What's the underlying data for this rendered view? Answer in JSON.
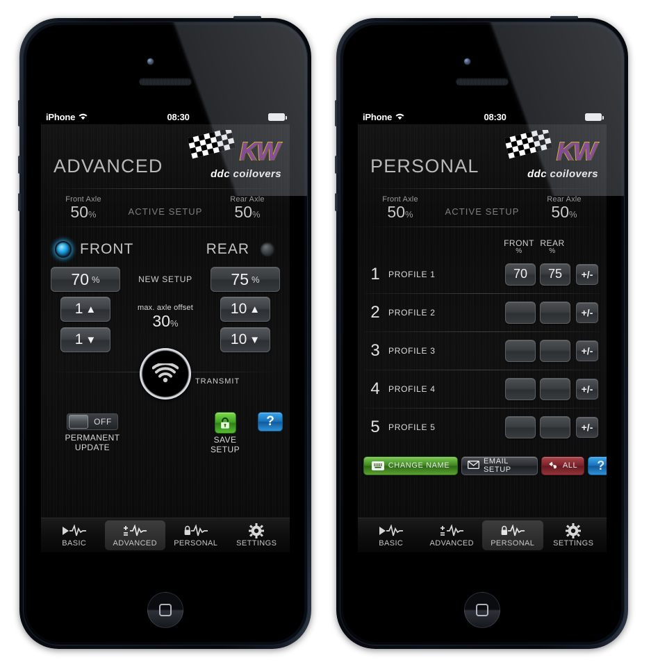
{
  "statusbar": {
    "carrier": "iPhone",
    "time": "08:30",
    "wifi_icon": "wifi-icon",
    "battery_icon": "battery-full-icon"
  },
  "brand": {
    "letters": "KW",
    "tagline": "ddc coilovers",
    "purple": "#7b2a8f",
    "gold": "#e0b400"
  },
  "advanced": {
    "title": "ADVANCED",
    "active_setup": {
      "label": "ACTIVE SETUP",
      "front_caption": "Front Axle",
      "front_value": "50",
      "rear_caption": "Rear Axle",
      "rear_value": "50",
      "unit": "%"
    },
    "axle_select": {
      "front_label": "FRONT",
      "rear_label": "REAR",
      "selected": "FRONT"
    },
    "new_setup": {
      "label": "NEW SETUP",
      "front_value": "70",
      "rear_value": "75",
      "unit": "%"
    },
    "steppers": {
      "front_up": "1",
      "front_down": "1",
      "rear_up": "10",
      "rear_down": "10",
      "up_arrow": "▲",
      "down_arrow": "▼"
    },
    "offset": {
      "caption": "max. axle offset",
      "value": "30",
      "unit": "%"
    },
    "transmit": {
      "label": "TRANSMIT",
      "icon": "wifi-transmit-icon"
    },
    "permanent_update": {
      "toggle_state": "OFF",
      "caption_line1": "PERMANENT",
      "caption_line2": "UPDATE"
    },
    "save_setup": {
      "caption_line1": "SAVE",
      "caption_line2": "SETUP",
      "icon": "lock-icon",
      "color": "#4fae28"
    },
    "help": {
      "label": "?",
      "color": "#1a72bb"
    }
  },
  "personal": {
    "title": "PERSONAL",
    "active_setup": {
      "label": "ACTIVE SETUP",
      "front_caption": "Front Axle",
      "front_value": "50",
      "rear_caption": "Rear Axle",
      "rear_value": "50",
      "unit": "%"
    },
    "columns": {
      "front": "FRONT",
      "rear": "REAR",
      "unit": "%"
    },
    "profiles": [
      {
        "num": "1",
        "name": "PROFILE 1",
        "front": "70",
        "rear": "75",
        "pm": "+/-"
      },
      {
        "num": "2",
        "name": "PROFILE 2",
        "front": "",
        "rear": "",
        "pm": "+/-"
      },
      {
        "num": "3",
        "name": "PROFILE 3",
        "front": "",
        "rear": "",
        "pm": "+/-"
      },
      {
        "num": "4",
        "name": "PROFILE 4",
        "front": "",
        "rear": "",
        "pm": "+/-"
      },
      {
        "num": "5",
        "name": "PROFILE 5",
        "front": "",
        "rear": "",
        "pm": "+/-"
      }
    ],
    "buttons": {
      "change_name": {
        "label": "CHANGE NAME",
        "icon": "keyboard-icon",
        "color": "#4f9a24"
      },
      "email_setup": {
        "label": "EMAIL SETUP",
        "icon": "envelope-icon",
        "color": "#2a2e32"
      },
      "all": {
        "label": "ALL",
        "icon": "undo-arrow-icon",
        "color": "#7c2229"
      },
      "help": {
        "label": "?",
        "color": "#1a72bb"
      }
    }
  },
  "tabs": [
    {
      "label": "BASIC",
      "icon": "play-waveform-icon"
    },
    {
      "label": "ADVANCED",
      "icon": "plusminus-waveform-icon"
    },
    {
      "label": "PERSONAL",
      "icon": "lock-waveform-icon"
    },
    {
      "label": "SETTINGS",
      "icon": "gear-icon"
    }
  ],
  "tabs_active": {
    "left_phone": "ADVANCED",
    "right_phone": "PERSONAL"
  }
}
